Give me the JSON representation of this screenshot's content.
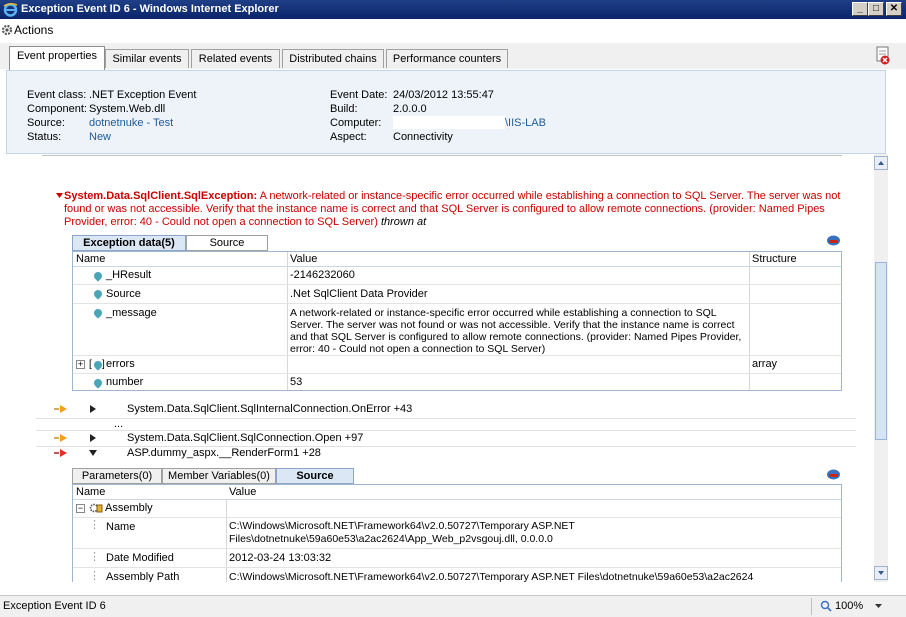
{
  "window": {
    "title": "Exception Event ID 6 - Windows Internet Explorer"
  },
  "toolbar": {
    "actions_label": "Actions"
  },
  "tabs": [
    {
      "label": "Event properties"
    },
    {
      "label": "Similar events"
    },
    {
      "label": "Related events"
    },
    {
      "label": "Distributed chains"
    },
    {
      "label": "Performance counters"
    }
  ],
  "event": {
    "class_label": "Event class:",
    "class_value": ".NET Exception Event",
    "component_label": "Component:",
    "component_value": "System.Web.dll",
    "source_label": "Source:",
    "source_value": "dotnetnuke - Test",
    "status_label": "Status:",
    "status_value": "New",
    "date_label": "Event Date:",
    "date_value": "24/03/2012 13:55:47",
    "build_label": "Build:",
    "build_value": "2.0.0.0",
    "computer_label": "Computer:",
    "computer_value": "\\IIS-LAB",
    "aspect_label": "Aspect:",
    "aspect_value": "Connectivity"
  },
  "exception": {
    "type": "System.Data.SqlClient.SqlException:",
    "message": " A network-related or instance-specific error occurred while establishing a connection to SQL Server. The server was not found or was not accessible. Verify that the instance name is correct and that SQL Server is configured to allow remote connections. (provider: Named Pipes Provider, error: 40 - Could not open a connection to SQL Server)",
    "suffix": "thrown at"
  },
  "exception_tabs": {
    "data": "Exception data(5)",
    "source": "Source"
  },
  "exception_grid": {
    "headers": {
      "name": "Name",
      "value": "Value",
      "structure": "Structure"
    },
    "rows": [
      {
        "name": "_HResult",
        "value": "-2146232060",
        "structure": ""
      },
      {
        "name": "Source",
        "value": ".Net SqlClient Data Provider",
        "structure": ""
      },
      {
        "name": "_message",
        "value": "A network-related or instance-specific error occurred while establishing a connection to SQL Server. The server was not found or was not accessible. Verify that the instance name is correct and that SQL Server is configured to allow remote connections. (provider: Named Pipes Provider, error: 40 - Could not open a connection to SQL Server)",
        "structure": ""
      },
      {
        "name": "errors",
        "value": "",
        "structure": "array"
      },
      {
        "name": "number",
        "value": "53",
        "structure": ""
      }
    ]
  },
  "stack": {
    "frame1": "System.Data.SqlClient.SqlInternalConnection.OnError +43",
    "ellipsis": "...",
    "frame2": "System.Data.SqlClient.SqlConnection.Open +97",
    "frame3": "ASP.dummy_aspx.__RenderForm1 +28"
  },
  "frame_tabs": {
    "params": "Parameters(0)",
    "members": "Member Variables(0)",
    "source": "Source"
  },
  "source_grid": {
    "headers": {
      "name": "Name",
      "value": "Value"
    },
    "group": "Assembly",
    "rows": [
      {
        "name": "Name",
        "value": "C:\\Windows\\Microsoft.NET\\Framework64\\v2.0.50727\\Temporary ASP.NET Files\\dotnetnuke\\59a60e53\\a2ac2624\\App_Web_p2vsgouj.dll, 0.0.0.0"
      },
      {
        "name": "Date Modified",
        "value": "2012-03-24 13:03:32"
      },
      {
        "name": "Assembly Path",
        "value": "C:\\Windows\\Microsoft.NET\\Framework64\\v2.0.50727\\Temporary ASP.NET Files\\dotnetnuke\\59a60e53\\a2ac2624"
      }
    ]
  },
  "statusbar": {
    "text": "Exception Event ID 6",
    "zoom": "100%"
  },
  "colors": {
    "title_bar": "#0a246a",
    "error_red": "#cc0000",
    "link": "#1f5c99",
    "info_panel": "#edf3f9"
  }
}
